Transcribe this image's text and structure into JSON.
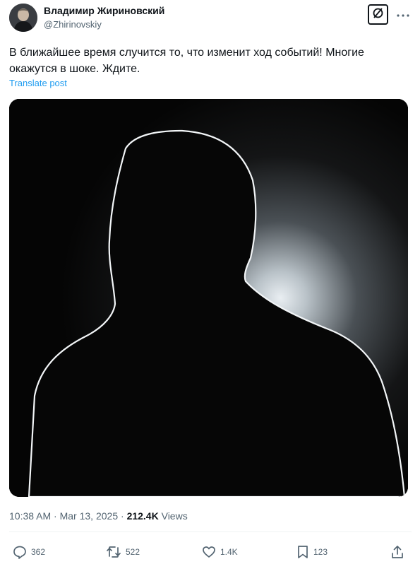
{
  "author": {
    "display_name": "Владимир Жириновский",
    "handle": "@Zhirinovskiy"
  },
  "tweet": {
    "text": "В ближайшее время случится то, что изменит ход событий! Многие окажутся в шоке. Ждите.",
    "translate_label": "Translate post"
  },
  "meta": {
    "time": "10:38 AM",
    "sep1": " · ",
    "date": "Mar 13, 2025",
    "sep2": " · ",
    "views_count": "212.4K",
    "views_label": " Views"
  },
  "actions": {
    "replies": "362",
    "reposts": "522",
    "likes": "1.4K",
    "bookmarks": "123"
  },
  "icons": [
    "grok-icon",
    "more-icon",
    "reply-icon",
    "repost-icon",
    "like-icon",
    "bookmark-icon",
    "share-icon"
  ]
}
